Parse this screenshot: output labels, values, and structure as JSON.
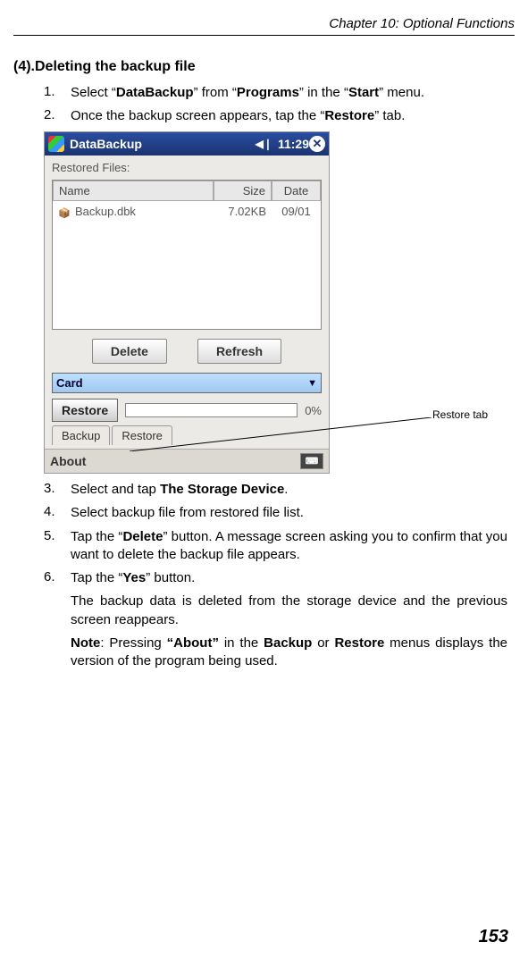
{
  "chapter": "Chapter 10: Optional Functions",
  "section_title": "(4).Deleting the backup file",
  "steps": {
    "s1_pre": "Select “",
    "s1_db": "DataBackup",
    "s1_mid1": "” from “",
    "s1_prog": "Programs",
    "s1_mid2": "” in the “",
    "s1_start": "Start",
    "s1_end": "” menu.",
    "s2_pre": "Once the backup screen appears, tap the “",
    "s2_restore": "Restore",
    "s2_end": "” tab.",
    "s3_pre": "Select and tap ",
    "s3_storage": "The Storage Device",
    "s3_end": ".",
    "s4": "Select backup file from restored file list.",
    "s5_pre": "Tap the “",
    "s5_delete": "Delete",
    "s5_end": "” button. A message screen asking you to confirm that you want to delete the backup file appears.",
    "s6_pre": "Tap the “",
    "s6_yes": "Yes",
    "s6_end": "” button.",
    "s6_para": "The backup data is deleted from the storage device and the previous screen reappears.",
    "note_label": "Note",
    "note_pre": ": Pressing ",
    "note_about": "“About”",
    "note_mid1": " in the ",
    "note_backup": "Backup",
    "note_mid2": " or ",
    "note_restore": "Restore",
    "note_end": " menus displays the version of the program being used."
  },
  "nums": {
    "n1": "1.",
    "n2": "2.",
    "n3": "3.",
    "n4": "4.",
    "n5": "5.",
    "n6": "6."
  },
  "screenshot": {
    "app_title": "DataBackup",
    "clock": "11:29",
    "subtitle": "Restored Files:",
    "cols": {
      "name": "Name",
      "size": "Size",
      "date": "Date"
    },
    "file": {
      "name": "Backup.dbk",
      "size": "7.02KB",
      "date": "09/01"
    },
    "btn_delete": "Delete",
    "btn_refresh": "Refresh",
    "combo_value": "Card",
    "btn_restore": "Restore",
    "progress_pct": "0%",
    "tab_backup": "Backup",
    "tab_restore": "Restore",
    "footer_about": "About"
  },
  "callout": "Restore tab",
  "page_number": "153"
}
